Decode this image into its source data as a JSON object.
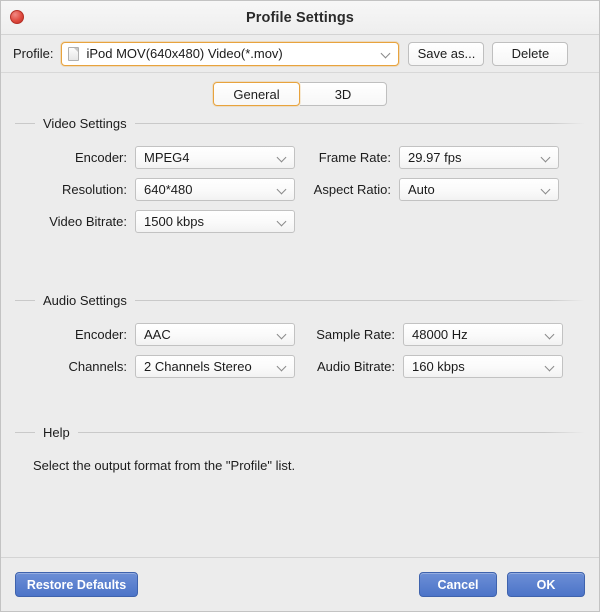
{
  "window": {
    "title": "Profile Settings",
    "close_icon": "close-icon"
  },
  "profile_bar": {
    "label": "Profile:",
    "selected_profile": "iPod MOV(640x480) Video(*.mov)",
    "profile_icon": "file-icon",
    "dropdown_icon": "chevron-down-icon",
    "save_as_label": "Save as...",
    "delete_label": "Delete"
  },
  "tabs": [
    {
      "label": "General",
      "selected": true
    },
    {
      "label": "3D",
      "selected": false
    }
  ],
  "video_settings": {
    "legend": "Video Settings",
    "fields": {
      "encoder_label": "Encoder:",
      "encoder_value": "MPEG4",
      "resolution_label": "Resolution:",
      "resolution_value": "640*480",
      "video_bitrate_label": "Video Bitrate:",
      "video_bitrate_value": "1500 kbps",
      "frame_rate_label": "Frame Rate:",
      "frame_rate_value": "29.97 fps",
      "aspect_ratio_label": "Aspect Ratio:",
      "aspect_ratio_value": "Auto"
    }
  },
  "audio_settings": {
    "legend": "Audio Settings",
    "fields": {
      "encoder_label": "Encoder:",
      "encoder_value": "AAC",
      "channels_label": "Channels:",
      "channels_value": "2 Channels Stereo",
      "sample_rate_label": "Sample Rate:",
      "sample_rate_value": "48000 Hz",
      "audio_bitrate_label": "Audio Bitrate:",
      "audio_bitrate_value": "160 kbps"
    }
  },
  "help": {
    "legend": "Help",
    "text": "Select the output format from the \"Profile\" list."
  },
  "footer": {
    "restore_defaults_label": "Restore Defaults",
    "cancel_label": "Cancel",
    "ok_label": "OK"
  },
  "colors": {
    "accent_orange": "#e8a33d",
    "primary_blue": "#4c74c8",
    "window_bg": "#ececec",
    "close_red": "#e04b40"
  }
}
